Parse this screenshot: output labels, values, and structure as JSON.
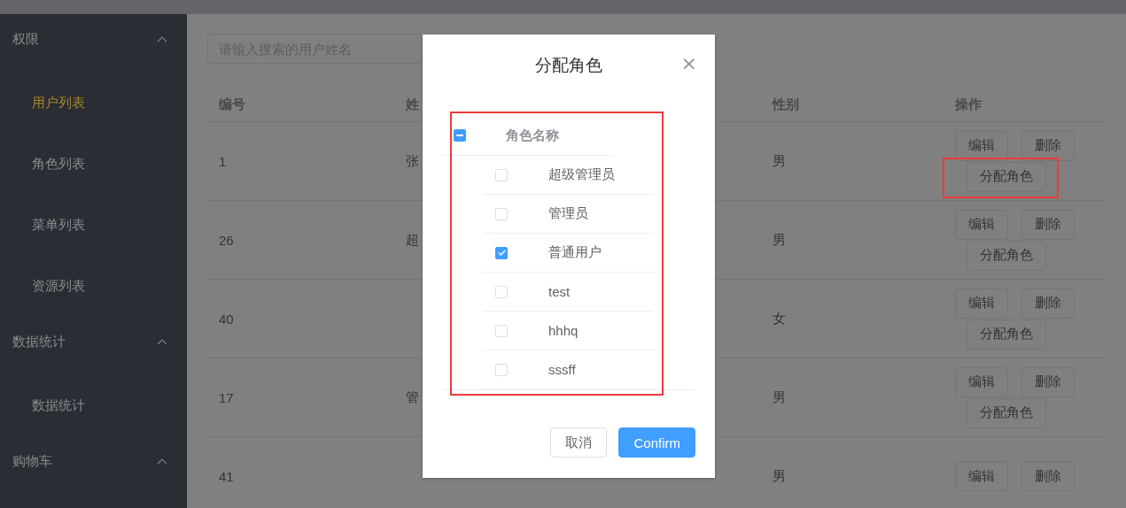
{
  "sidebar": {
    "groups": [
      {
        "title": "权限",
        "expanded": true,
        "items": [
          {
            "label": "用户列表",
            "selected": true
          },
          {
            "label": "角色列表",
            "selected": false
          },
          {
            "label": "菜单列表",
            "selected": false
          },
          {
            "label": "资源列表",
            "selected": false
          }
        ]
      },
      {
        "title": "数据统计",
        "expanded": true,
        "items": [
          {
            "label": "数据统计",
            "selected": false
          }
        ]
      },
      {
        "title": "购物车",
        "expanded": true
      }
    ]
  },
  "search": {
    "placeholder": "请输入搜索的用户姓名"
  },
  "table": {
    "columns": [
      "编号",
      "姓",
      "",
      "性别",
      "操作"
    ],
    "rows": [
      {
        "cells": [
          "1",
          "张",
          "",
          "男"
        ],
        "actions": [
          "编辑",
          "删除",
          "分配角色"
        ],
        "annotated": true
      },
      {
        "cells": [
          "26",
          "超",
          "",
          "男"
        ],
        "actions": [
          "编辑",
          "删除",
          "分配角色"
        ],
        "annotated": false
      },
      {
        "cells": [
          "40",
          "",
          "",
          "女"
        ],
        "actions": [
          "编辑",
          "删除",
          "分配角色"
        ],
        "annotated": false
      },
      {
        "cells": [
          "17",
          "管",
          "",
          "男"
        ],
        "actions": [
          "编辑",
          "删除",
          "分配角色"
        ],
        "annotated": false
      },
      {
        "cells": [
          "41",
          "",
          "",
          "男"
        ],
        "actions": [
          "编辑",
          "删除"
        ],
        "annotated": false
      }
    ]
  },
  "dialog": {
    "title": "分配角色",
    "close": "×",
    "annotated": true,
    "role_table": {
      "header": "角色名称",
      "select_all": {
        "indeterminate": true
      },
      "roles": [
        {
          "name": "超级管理员",
          "checked": false
        },
        {
          "name": "管理员",
          "checked": false
        },
        {
          "name": "普通用户",
          "checked": true
        },
        {
          "name": "test",
          "checked": false
        },
        {
          "name": "hhhq",
          "checked": false
        },
        {
          "name": "sssff",
          "checked": false
        }
      ]
    },
    "buttons": [
      {
        "label": "取消",
        "kind": "plain"
      },
      {
        "label": "Confirm",
        "kind": "primary"
      }
    ]
  }
}
